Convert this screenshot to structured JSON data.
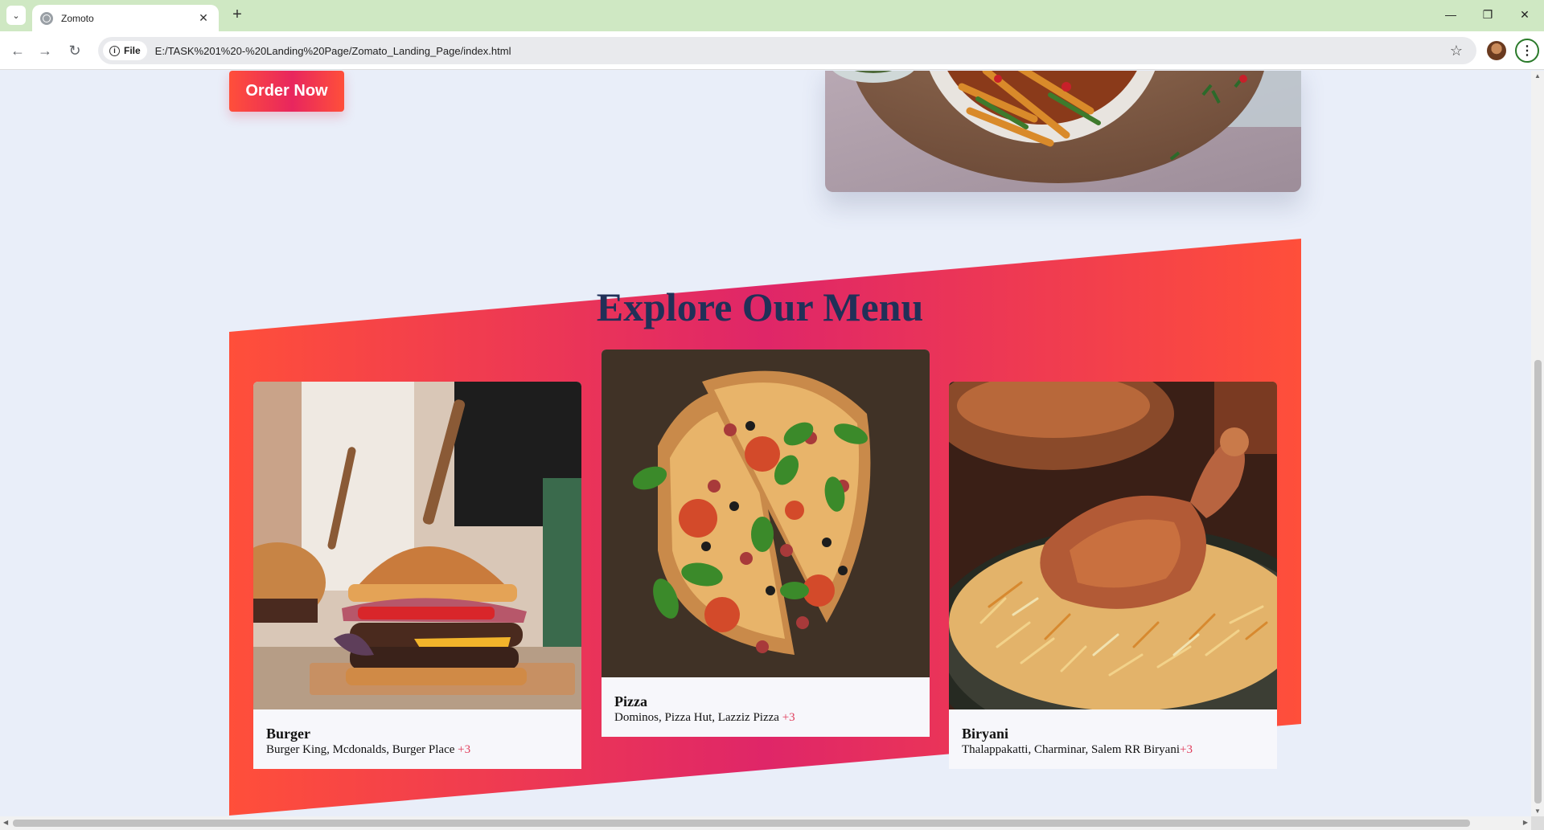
{
  "browser": {
    "tab_title": "Zomoto",
    "tab_close": "✕",
    "new_tab": "+",
    "site_chip": "File",
    "url": "E:/TASK%201%20-%20Landing%20Page/Zomato_Landing_Page/index.html",
    "icons": {
      "tab_search": "chevron-down-icon",
      "back": "back-arrow-icon",
      "forward": "forward-arrow-icon",
      "reload": "reload-icon",
      "bookmark": "star-icon",
      "menu": "kebab-menu-icon"
    }
  },
  "hero": {
    "order_button": "Order Now"
  },
  "menu": {
    "title": "Explore Our Menu",
    "cards": [
      {
        "name": "Burger",
        "places": "Burger King, Mcdonalds, Burger Place ",
        "more": "+3"
      },
      {
        "name": "Pizza",
        "places": "Dominos, Pizza Hut, Lazziz Pizza ",
        "more": "+3"
      },
      {
        "name": "Biryani",
        "places": "Thalappakatti, Charminar, Salem RR Biryani",
        "more": "+3"
      }
    ]
  },
  "colors": {
    "page_bg": "#e9eef9",
    "accent_start": "#ff4f3a",
    "accent_mid": "#df2668",
    "title": "#213058",
    "more_badge": "#e03c5a"
  }
}
